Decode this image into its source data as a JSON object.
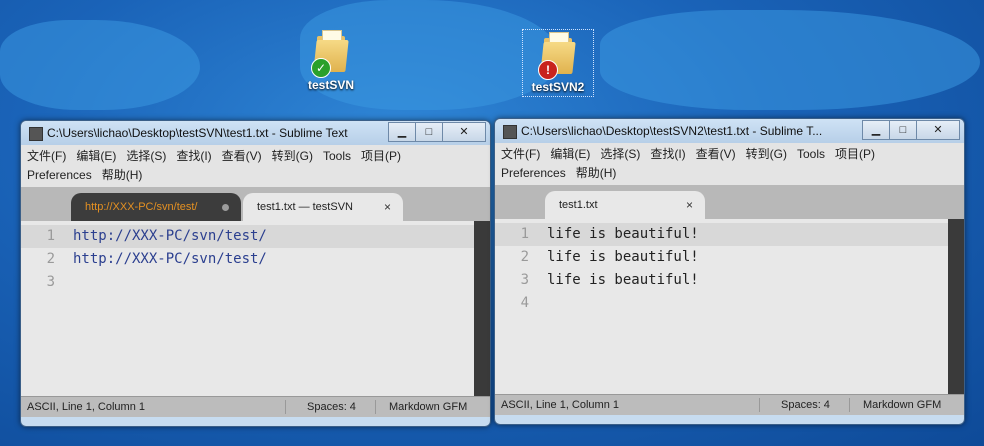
{
  "desktop": {
    "icons": [
      {
        "label": "testSVN",
        "status": "ok"
      },
      {
        "label": "testSVN2",
        "status": "conflict"
      }
    ]
  },
  "windows": [
    {
      "title": "C:\\Users\\lichao\\Desktop\\testSVN\\test1.txt - Sublime Text",
      "menu_row1": [
        "文件(F)",
        "编辑(E)",
        "选择(S)",
        "查找(I)",
        "查看(V)",
        "转到(G)",
        "Tools",
        "项目(P)"
      ],
      "menu_row2": [
        "Preferences",
        "帮助(H)"
      ],
      "tabs": [
        {
          "label": "http://XXX-PC/svn/test/",
          "active": true,
          "modified": true
        },
        {
          "label": "test1.txt — testSVN",
          "active": false
        }
      ],
      "lines": [
        {
          "num": "1",
          "text": "http://XXX-PC/svn/test/"
        },
        {
          "num": "2",
          "text": "http://XXX-PC/svn/test/"
        },
        {
          "num": "3",
          "text": ""
        }
      ],
      "status": {
        "position": "ASCII, Line 1, Column 1",
        "spaces": "Spaces: 4",
        "syntax": "Markdown GFM"
      }
    },
    {
      "title": "C:\\Users\\lichao\\Desktop\\testSVN2\\test1.txt - Sublime T...",
      "menu_row1": [
        "文件(F)",
        "编辑(E)",
        "选择(S)",
        "查找(I)",
        "查看(V)",
        "转到(G)",
        "Tools",
        "项目(P)"
      ],
      "menu_row2": [
        "Preferences",
        "帮助(H)"
      ],
      "tabs": [
        {
          "label": "test1.txt",
          "active": true
        }
      ],
      "lines": [
        {
          "num": "1",
          "text": "life is beautiful!"
        },
        {
          "num": "2",
          "text": "life is beautiful!"
        },
        {
          "num": "3",
          "text": "life is beautiful!"
        },
        {
          "num": "4",
          "text": ""
        }
      ],
      "status": {
        "position": "ASCII, Line 1, Column 1",
        "spaces": "Spaces: 4",
        "syntax": "Markdown GFM"
      }
    }
  ],
  "window_controls": {
    "minimize": "▁",
    "maximize": "□",
    "close": "✕"
  },
  "tab_close_glyph": "×",
  "colors": {
    "tab_active_text": "#e49022",
    "code_blue": "#2b3f8f"
  }
}
